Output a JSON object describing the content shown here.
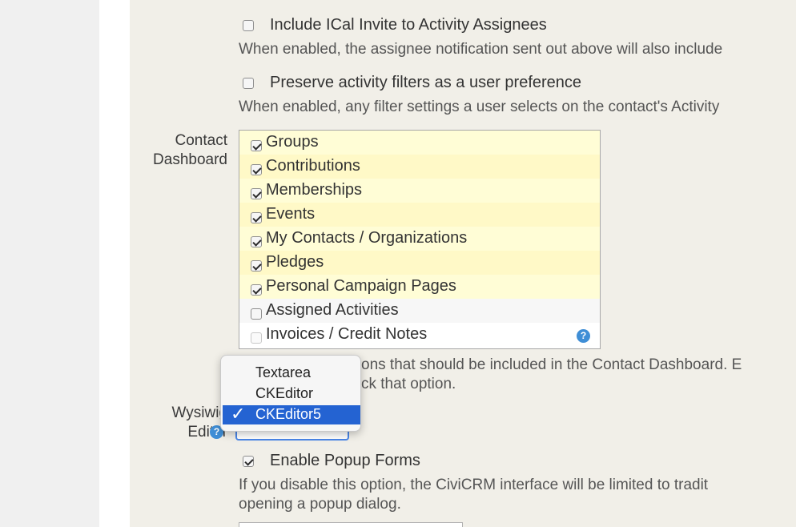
{
  "activity_options": [
    {
      "label": "Include ICal Invite to Activity Assignees",
      "checked": false,
      "description": "When enabled, the assignee notification sent out above will also include"
    },
    {
      "label": "Preserve activity filters as a user preference",
      "checked": false,
      "description": "When enabled, any filter settings a user selects on the contact's Activity"
    }
  ],
  "contact_dashboard": {
    "label_line1": "Contact",
    "label_line2": "Dashboard",
    "items": [
      {
        "label": "Groups",
        "checked": true
      },
      {
        "label": "Contributions",
        "checked": true
      },
      {
        "label": "Memberships",
        "checked": true
      },
      {
        "label": "Events",
        "checked": true
      },
      {
        "label": "My Contacts / Organizations",
        "checked": true
      },
      {
        "label": "Pledges",
        "checked": true
      },
      {
        "label": "Personal Campaign Pages",
        "checked": true
      },
      {
        "label": "Assigned Activities",
        "checked": false
      },
      {
        "label": "Invoices / Credit Notes",
        "checked": false
      }
    ],
    "help_icon": "question-icon",
    "description_line1_visible": "ons that should be included in the Contact Dashboard. E",
    "description_line2_visible": "ck that option."
  },
  "wysiwyg": {
    "label_line1_visible": "Wysiwig",
    "label_line2": "Editor",
    "help_icon": "question-icon",
    "options": [
      "Textarea",
      "CKEditor",
      "CKEditor5"
    ],
    "selected": "CKEditor5",
    "check_glyph": "✓"
  },
  "popup_forms": {
    "label": "Enable Popup Forms",
    "checked": true,
    "description_line1": "If you disable this option, the CiviCRM interface will be limited to tradit",
    "description_line2": "opening a popup dialog."
  }
}
